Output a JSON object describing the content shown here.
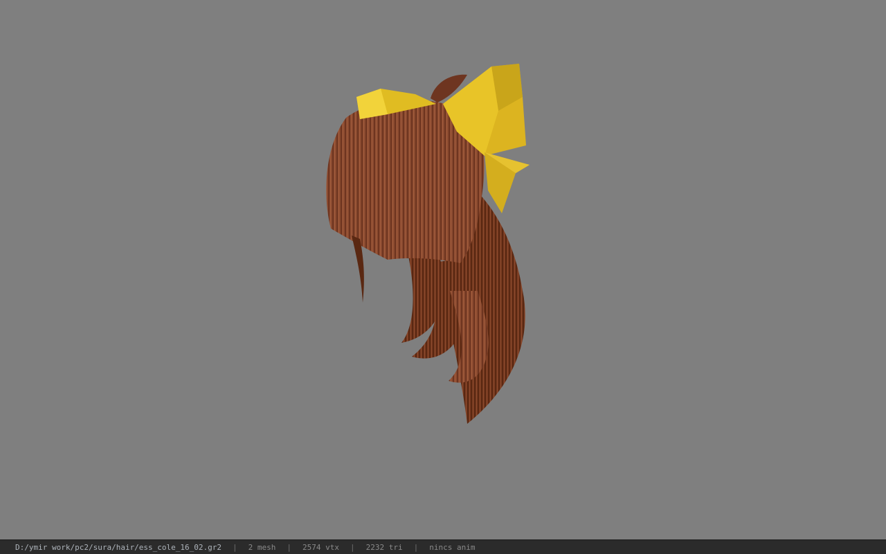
{
  "status": {
    "file_path": "D:/ymir work/pc2/sura/hair/ess_cole_16_02.gr2",
    "separator": "|",
    "mesh_count": "2 mesh",
    "vertex_count": "2574 vtx",
    "triangle_count": "2232 tri",
    "anim_status": "nincs anim"
  },
  "colors": {
    "background": "#7f7f7f",
    "hair": "#8a4a2e",
    "ribbon": "#e8c428",
    "statusbar": "#2b2b2b"
  }
}
